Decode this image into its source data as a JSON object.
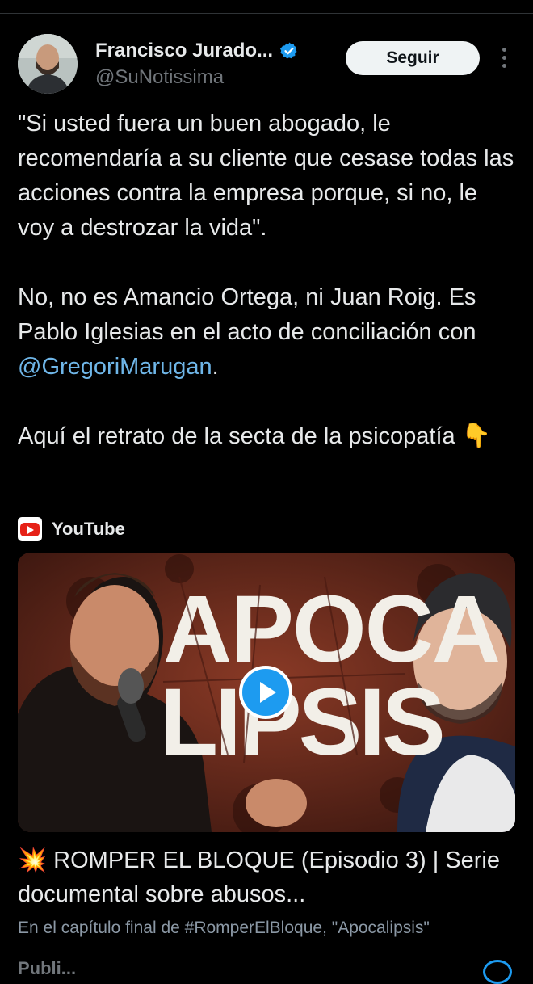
{
  "tweet": {
    "author": {
      "display_name": "Francisco Jurado...",
      "handle": "@SuNotissima",
      "verified": true
    },
    "follow_label": "Seguir",
    "paragraphs": [
      "\"Si usted fuera un buen abogado, le recomendaría a su cliente que cesase todas las acciones contra la empresa porque, si no, le voy a destrozar la vida\"."
    ],
    "p2_before": "No, no es Amancio Ortega, ni Juan Roig. Es Pablo Iglesias en el acto de conciliación con ",
    "p2_mention": "@GregoriMarugan",
    "p2_after": ".",
    "p3": "Aquí el retrato de la secta de la psicopatía 👇"
  },
  "card": {
    "source": "YouTube",
    "thumbnail_text_line1": "APOCA",
    "thumbnail_text_line2": "LIPSIS",
    "title": "💥 ROMPER EL BLOQUE (Episodio 3) | Serie documental sobre abusos...",
    "description": "En el capítulo final de #RomperElBloque, \"Apocalipsis\""
  },
  "bottom": {
    "peek_text": "Publi..."
  },
  "colors": {
    "background": "#000000",
    "text": "#e7e9ea",
    "secondary": "#71767b",
    "mention": "#6fb6e8",
    "accent": "#1d9bf0"
  }
}
